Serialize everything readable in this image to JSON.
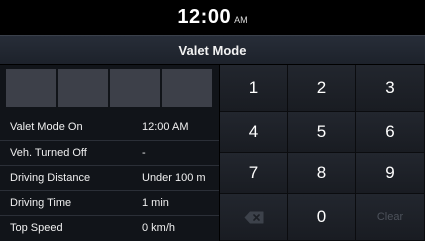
{
  "status": {
    "time": "12:00",
    "ampm": "AM"
  },
  "header": {
    "title": "Valet Mode"
  },
  "pin": {
    "boxes": [
      "",
      "",
      "",
      ""
    ]
  },
  "info": [
    {
      "label": "Valet Mode On",
      "value": "12:00 AM"
    },
    {
      "label": "Veh. Turned Off",
      "value": "-"
    },
    {
      "label": "Driving Distance",
      "value": "Under 100 m"
    },
    {
      "label": "Driving Time",
      "value": "1 min"
    },
    {
      "label": "Top Speed",
      "value": "0 km/h"
    }
  ],
  "keypad": {
    "keys": [
      "1",
      "2",
      "3",
      "4",
      "5",
      "6",
      "7",
      "8",
      "9"
    ],
    "zero": "0",
    "clear": "Clear",
    "backspace_icon": "backspace-icon"
  },
  "colors": {
    "background": "#000000",
    "panel": "#111419",
    "pin_box": "#3d4049",
    "disabled_text": "#4d525b"
  }
}
